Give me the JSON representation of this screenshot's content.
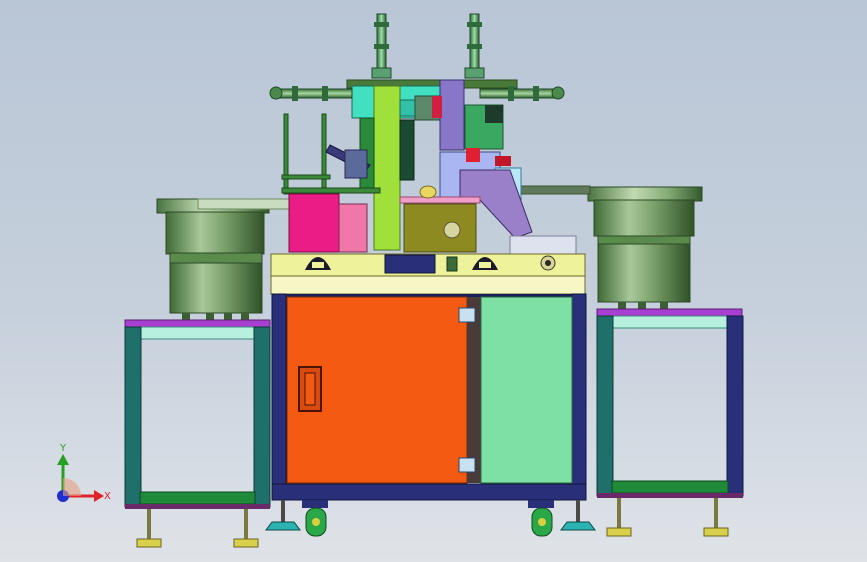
{
  "axes_triad": {
    "x_label": "X",
    "y_label": "Y",
    "x_color": "#e0202a",
    "y_color": "#25a025",
    "z_color": "#2030d0"
  },
  "colors": {
    "frame": "#2a2f7a",
    "door_left": "#f45a12",
    "door_right": "#7fe0a4",
    "bowl": "#6f9a5c",
    "table_top": "#eef29a",
    "stand_top": "#a83fd0",
    "stand_leg": "#1f6f6a",
    "caster": "#2ab3b0",
    "pink": "#ea1d86",
    "olive": "#8e8a22",
    "lavender": "#8877c8",
    "lime": "#9fe03a"
  }
}
